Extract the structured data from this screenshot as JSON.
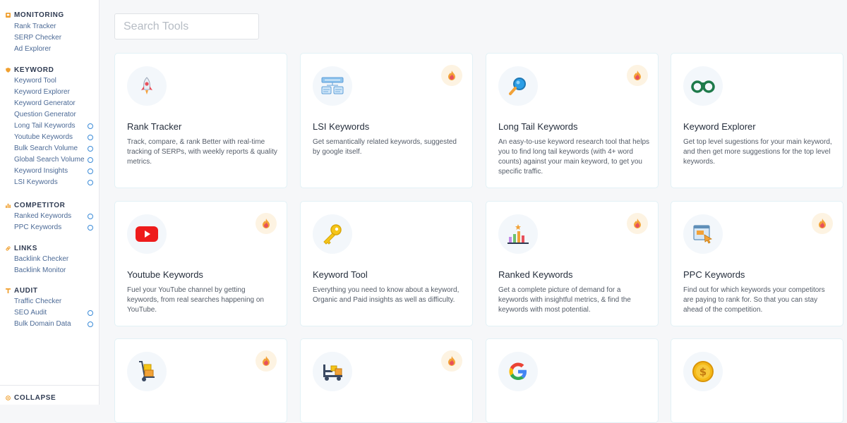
{
  "search": {
    "placeholder": "Search Tools"
  },
  "sidebar": {
    "monitoring": {
      "title": "MONITORING",
      "items": [
        "Rank Tracker",
        "SERP Checker",
        "Ad Explorer"
      ]
    },
    "keyword": {
      "title": "KEYWORD",
      "items": [
        "Keyword Tool",
        "Keyword Explorer",
        "Keyword Generator",
        "Question Generator",
        "Long Tail Keywords",
        "Youtube Keywords",
        "Bulk Search Volume",
        "Global Search Volume",
        "Keyword Insights",
        "LSI Keywords"
      ]
    },
    "competitor": {
      "title": "COMPETITOR",
      "items": [
        "Ranked Keywords",
        "PPC Keywords"
      ]
    },
    "links": {
      "title": "LINKS",
      "items": [
        "Backlink Checker",
        "Backlink Monitor"
      ]
    },
    "audit": {
      "title": "AUDIT",
      "items": [
        "Traffic Checker",
        "SEO Audit",
        "Bulk Domain Data"
      ]
    },
    "collapse_label": "COLLAPSE"
  },
  "cards": [
    {
      "title": "Rank Tracker",
      "desc": "Track, compare, & rank Better with real-time tracking of SERPs, with weekly reports & quality metrics.",
      "icon": "rocket-icon"
    },
    {
      "title": "LSI Keywords",
      "desc": "Get semantically related keywords, suggested by google itself.",
      "icon": "flowchart-icon"
    },
    {
      "title": "Long Tail Keywords",
      "desc": "An easy-to-use keyword research tool that helps you to find long tail keywords (with 4+ word counts) against your main keyword, to get you specific traffic.",
      "icon": "magnifier-icon"
    },
    {
      "title": "Keyword Explorer",
      "desc": "Get top level sugestions for your main keyword, and then get more suggestions for the top level keywords.",
      "icon": "binoculars-icon"
    },
    {
      "title": "Youtube Keywords",
      "desc": "Fuel your YouTube channel by getting keywords, from real searches happening on YouTube.",
      "icon": "youtube-icon"
    },
    {
      "title": "Keyword Tool",
      "desc": "Everything you need to know about a keyword, Organic and Paid insights as well as difficulty.",
      "icon": "key-icon"
    },
    {
      "title": "Ranked Keywords",
      "desc": "Get a complete picture of demand for a keywords with insightful metrics, & find the keywords with most potential.",
      "icon": "bar-chart-icon"
    },
    {
      "title": "PPC Keywords",
      "desc": "Find out for which keywords your competitors are paying to rank for. So that you can stay ahead of the competition.",
      "icon": "ad-click-icon"
    },
    {
      "title": "",
      "desc": "",
      "icon": "hand-truck-icon"
    },
    {
      "title": "",
      "desc": "",
      "icon": "forklift-icon"
    },
    {
      "title": "",
      "desc": "",
      "icon": "google-icon"
    },
    {
      "title": "",
      "desc": "",
      "icon": "dollar-coin-icon"
    }
  ],
  "colors": {
    "fire_bg": "#fdf3e2",
    "link": "#4c6a96",
    "dot": "#3b8bd8"
  }
}
